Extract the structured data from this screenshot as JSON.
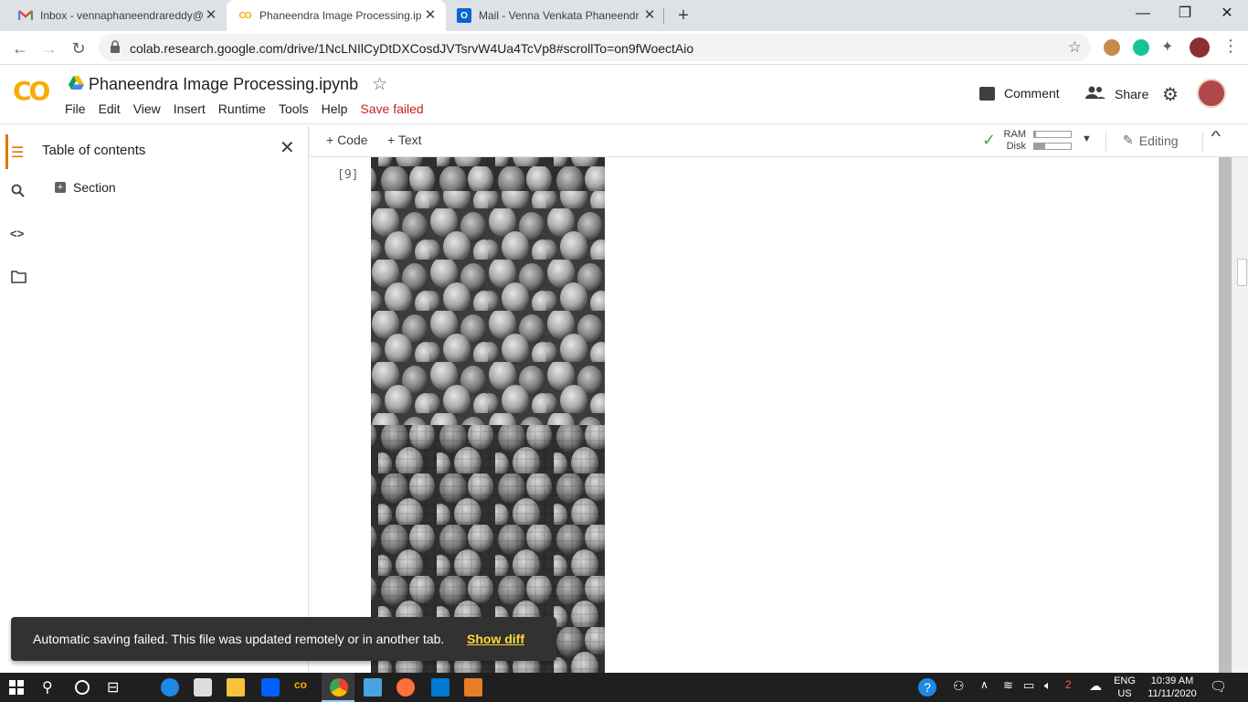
{
  "browser": {
    "tabs": [
      {
        "title": "Inbox - vennaphaneendrareddy@",
        "favicon": "gmail-icon",
        "active": false
      },
      {
        "title": "Phaneendra Image Processing.ip",
        "favicon": "colab-icon",
        "active": true
      },
      {
        "title": "Mail - Venna Venkata Phaneendr",
        "favicon": "outlook-icon",
        "active": false
      }
    ],
    "new_tab_label": "+",
    "url": "colab.research.google.com/drive/1NcLNIlCyDtDXCosdJVTsrvW4Ua4TcVp8#scrollTo=on9fWoectAio"
  },
  "colab": {
    "logo": "CO",
    "doc_title": "Phaneendra Image Processing.ipynb",
    "menu": [
      "File",
      "Edit",
      "View",
      "Insert",
      "Runtime",
      "Tools",
      "Help"
    ],
    "save_status": "Save failed",
    "comment_label": "Comment",
    "share_label": "Share"
  },
  "sidebar": {
    "toc_title": "Table of contents",
    "sections": [
      "Section"
    ]
  },
  "cell_toolbar": {
    "add_code": "+ Code",
    "add_text": "+ Text",
    "ram_label": "RAM",
    "disk_label": "Disk",
    "ram_usage": 0.05,
    "disk_usage": 0.3,
    "editing_label": "Editing"
  },
  "cell": {
    "execution_count": "[9]"
  },
  "snackbar": {
    "message": "Automatic saving failed. This file was updated remotely or in another tab.",
    "action": "Show diff"
  },
  "taskbar": {
    "lang": "ENG",
    "region": "US",
    "time": "10:39 AM",
    "date": "11/11/2020",
    "notif_count": "2"
  },
  "colors": {
    "accent_orange": "#f9ab00",
    "error_red": "#c5221f",
    "snackbar_link": "#fdd835"
  }
}
